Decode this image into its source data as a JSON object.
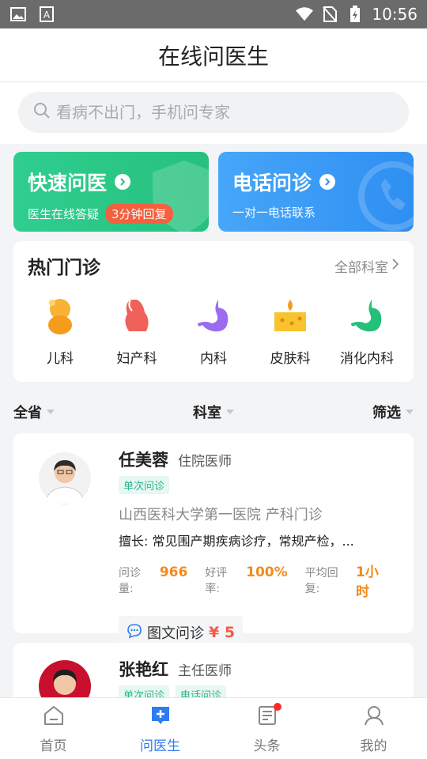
{
  "status_bar": {
    "time": "10:56"
  },
  "header": {
    "title": "在线问医生"
  },
  "search": {
    "placeholder": "看病不出门，手机问专家"
  },
  "quick": {
    "fast": {
      "title": "快速问医",
      "subtitle": "医生在线答疑",
      "badge": "3分钟回复"
    },
    "phone": {
      "title": "电话问诊",
      "subtitle": "一对一电话联系"
    }
  },
  "hot": {
    "title": "热门门诊",
    "all_label": "全部科室",
    "departments": [
      {
        "label": "儿科",
        "icon": "baby-icon"
      },
      {
        "label": "妇产科",
        "icon": "uterus-icon"
      },
      {
        "label": "内科",
        "icon": "stomach-icon"
      },
      {
        "label": "皮肤科",
        "icon": "skin-icon"
      },
      {
        "label": "消化内科",
        "icon": "digestive-icon"
      }
    ]
  },
  "filter": {
    "region": "全省",
    "dept": "科室",
    "filter": "筛选"
  },
  "doctors": [
    {
      "name": "任美蓉",
      "rank": "住院医师",
      "tags": [
        "单次问诊"
      ],
      "hospital": "山西医科大学第一医院 产科门诊",
      "skill": "擅长: 常见围产期疾病诊疗，常规产检，...",
      "stats": {
        "consult_label": "问诊量:",
        "consult_value": "966",
        "rating_label": "好评率:",
        "rating_value": "100%",
        "reply_label": "平均回复:",
        "reply_value": "1小时"
      },
      "service": {
        "label": "图文问诊",
        "price": "¥ 5"
      }
    },
    {
      "name": "张艳红",
      "rank": "主任医师",
      "tags": [
        "单次问诊",
        "电话问诊"
      ]
    }
  ],
  "tabbar": {
    "items": [
      {
        "label": "首页"
      },
      {
        "label": "问医生"
      },
      {
        "label": "头条"
      },
      {
        "label": "我的"
      }
    ]
  },
  "colors": {
    "accent": "#2f7cf0",
    "green": "#2bc084",
    "orange": "#f28a1c",
    "price": "#f25b4a"
  }
}
